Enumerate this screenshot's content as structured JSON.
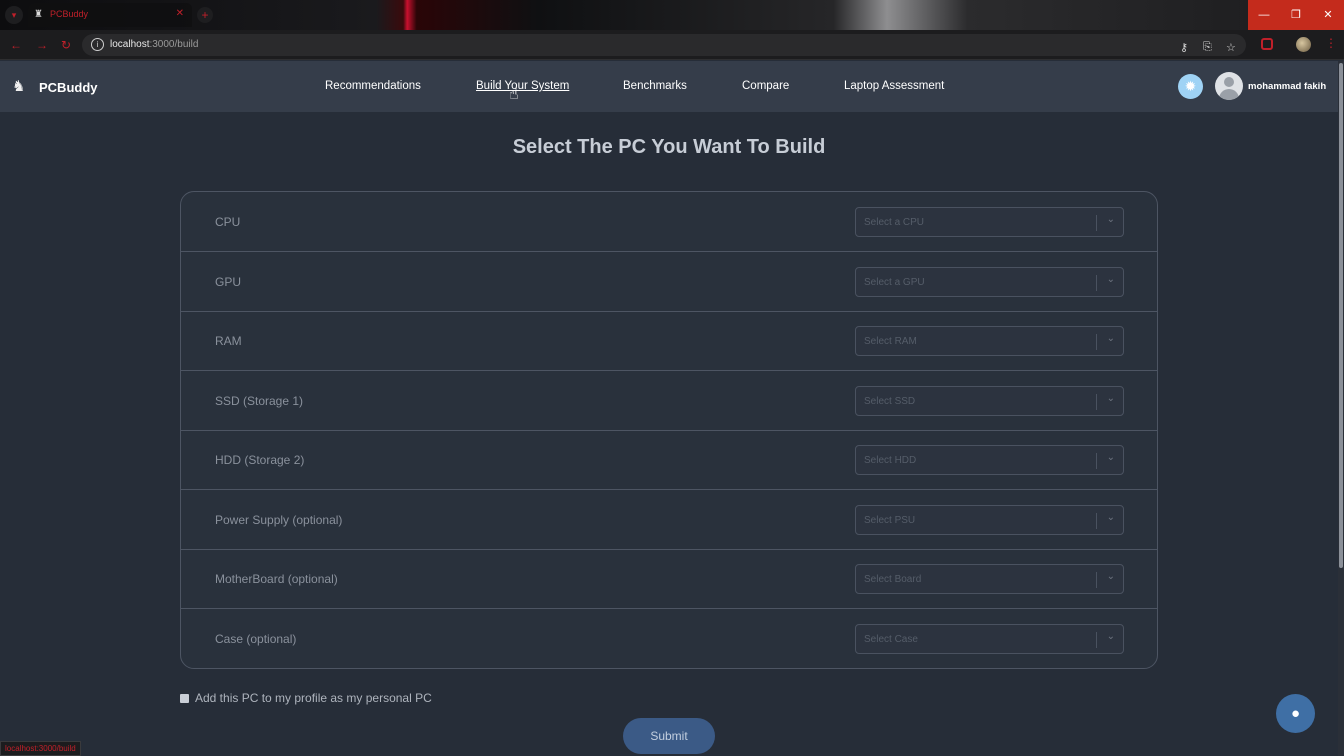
{
  "browser": {
    "tab_title": "PCBuddy",
    "url_host": "localhost",
    "url_path": ":3000/build",
    "status_url": "localhost:3000/build"
  },
  "header": {
    "brand": "PCBuddy",
    "nav": [
      {
        "label": "Recommendations"
      },
      {
        "label": "Build Your System",
        "active": true
      },
      {
        "label": "Benchmarks"
      },
      {
        "label": "Compare"
      },
      {
        "label": "Laptop Assessment"
      }
    ],
    "username": "mohammad fakih"
  },
  "main": {
    "title": "Select The PC You Want To Build",
    "parts": [
      {
        "label": "CPU",
        "placeholder": "Select a CPU"
      },
      {
        "label": "GPU",
        "placeholder": "Select a GPU"
      },
      {
        "label": "RAM",
        "placeholder": "Select RAM"
      },
      {
        "label": "SSD (Storage 1)",
        "placeholder": "Select SSD"
      },
      {
        "label": "HDD (Storage 2)",
        "placeholder": "Select HDD"
      },
      {
        "label": "Power Supply (optional)",
        "placeholder": "Select PSU"
      },
      {
        "label": "MotherBoard (optional)",
        "placeholder": "Select Board"
      },
      {
        "label": "Case (optional)",
        "placeholder": "Select Case"
      }
    ],
    "profile_checkbox_label": "Add this PC to my profile as my personal PC",
    "profile_checkbox_checked": false,
    "submit_label": "Submit"
  },
  "icons": {
    "logo": "pc-user-icon",
    "theme": "gear-sun-icon",
    "chat": "chat-bubble-icon"
  },
  "colors": {
    "page_bg": "#262d38",
    "header_bg": "#353d4a",
    "submit_bg": "#3b5a86",
    "chat_bg": "#3f6fa5",
    "theme_btn": "#9fd3f5"
  }
}
